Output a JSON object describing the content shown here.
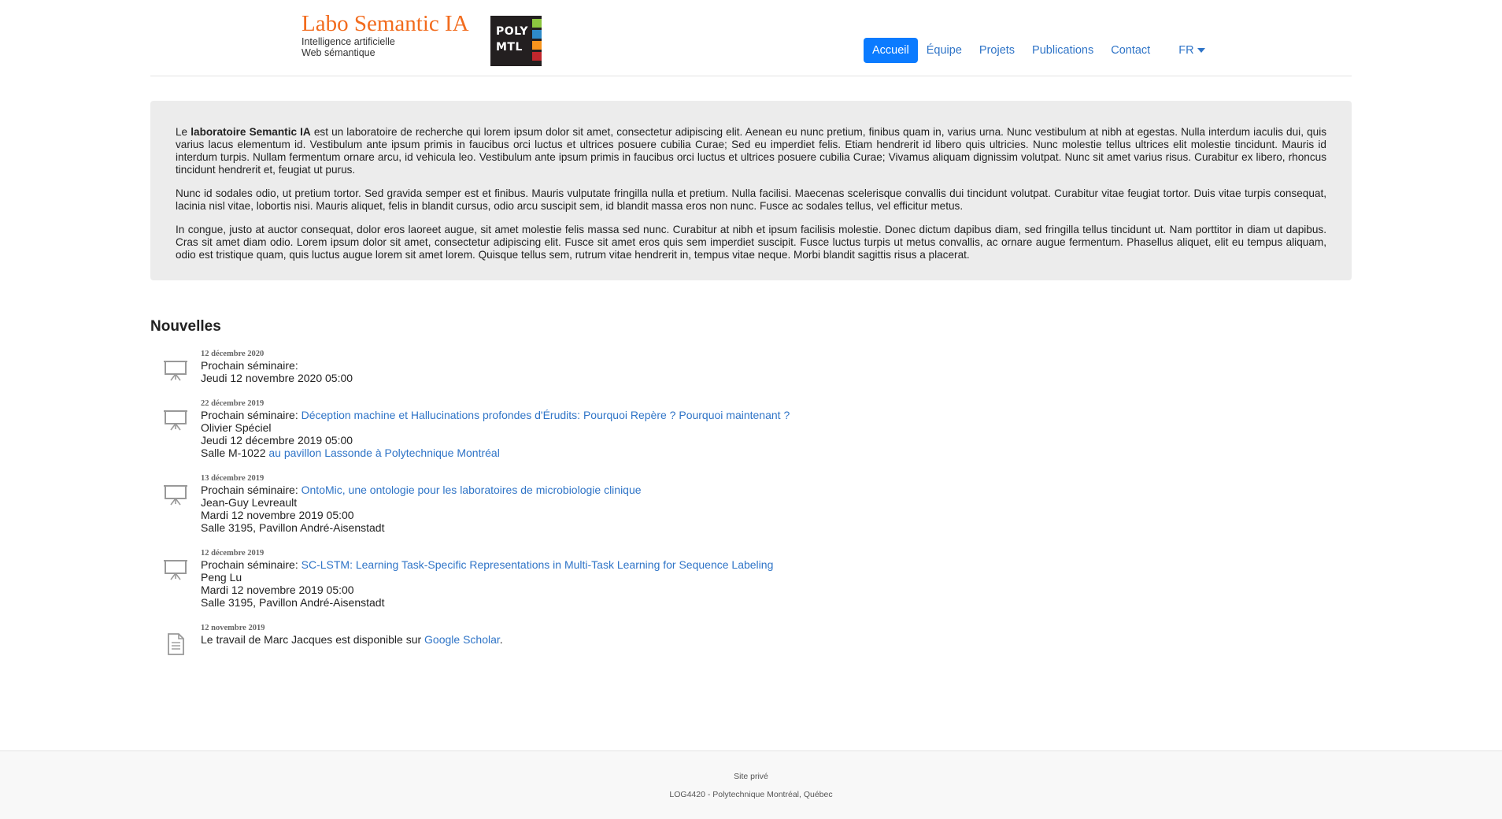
{
  "brand": {
    "title": "Labo Semantic IA",
    "subtitle_1": "Intelligence artificielle",
    "subtitle_2": "Web sémantique",
    "logo_line_1": "POLY",
    "logo_line_2": "MTL",
    "logo_colors": [
      "#8cc63f",
      "#2e8bc9",
      "#f7941d",
      "#c1272d"
    ]
  },
  "nav": {
    "items": [
      {
        "label": "Accueil",
        "active": true
      },
      {
        "label": "Équipe"
      },
      {
        "label": "Projets"
      },
      {
        "label": "Publications"
      },
      {
        "label": "Contact"
      }
    ],
    "lang": "FR"
  },
  "intro": {
    "p1_prefix": "Le ",
    "p1_bold": "laboratoire Semantic IA",
    "p1_rest": " est un laboratoire de recherche qui lorem ipsum dolor sit amet, consectetur adipiscing elit. Aenean eu nunc pretium, finibus quam in, varius urna. Nunc vestibulum at nibh at egestas. Nulla interdum iaculis dui, quis varius lacus elementum id. Vestibulum ante ipsum primis in faucibus orci luctus et ultrices posuere cubilia Curae; Sed eu imperdiet felis. Etiam hendrerit id libero quis ultricies. Nunc molestie tellus ultrices elit molestie tincidunt. Mauris id interdum turpis. Nullam fermentum ornare arcu, id vehicula leo. Vestibulum ante ipsum primis in faucibus orci luctus et ultrices posuere cubilia Curae; Vivamus aliquam dignissim volutpat. Nunc sit amet varius risus. Curabitur ex libero, rhoncus tincidunt hendrerit et, feugiat ut purus.",
    "p2": "Nunc id sodales odio, ut pretium tortor. Sed gravida semper est et finibus. Mauris vulputate fringilla nulla et pretium. Nulla facilisi. Maecenas scelerisque convallis dui tincidunt volutpat. Curabitur vitae feugiat tortor. Duis vitae turpis consequat, lacinia nisl vitae, lobortis nisi. Mauris aliquet, felis in blandit cursus, odio arcu suscipit sem, id blandit massa eros non nunc. Fusce ac sodales tellus, vel efficitur metus.",
    "p3": "In congue, justo at auctor consequat, dolor eros laoreet augue, sit amet molestie felis massa sed nunc. Curabitur at nibh et ipsum facilisis molestie. Donec dictum dapibus diam, sed fringilla tellus tincidunt ut. Nam porttitor in diam ut dapibus. Cras sit amet diam odio. Lorem ipsum dolor sit amet, consectetur adipiscing elit. Fusce sit amet eros quis sem imperdiet suscipit. Fusce luctus turpis ut metus convallis, ac ornare augue fermentum. Phasellus aliquet, elit eu tempus aliquam, odio est tristique quam, quis luctus augue lorem sit amet lorem. Quisque tellus sem, rutrum vitae hendrerit in, tempus vitae neque. Morbi blandit sagittis risus a placerat."
  },
  "news": {
    "title": "Nouvelles",
    "items": [
      {
        "date": "12 décembre 2020",
        "prefix": "Prochain séminaire:",
        "link": "",
        "lines": [
          "Jeudi 12 novembre 2020 05:00"
        ]
      },
      {
        "date": "22 décembre 2019",
        "prefix": "Prochain séminaire:",
        "link": "Déception machine et Hallucinations profondes d'Érudits: Pourquoi Repère ? Pourquoi maintenant ?",
        "lines": [
          "Olivier Spéciel",
          "Jeudi 12 décembre 2019 05:00"
        ],
        "room_prefix": "Salle M-1022",
        "room_link": "au pavillon Lassonde à Polytechnique Montréal"
      },
      {
        "date": "13 décembre 2019",
        "prefix": "Prochain séminaire:",
        "link": "OntoMic, une ontologie pour les laboratoires de microbiologie clinique",
        "lines": [
          "Jean-Guy Levreault",
          "Mardi 12 novembre 2019 05:00",
          "Salle 3195, Pavillon André-Aisenstadt"
        ]
      },
      {
        "date": "12 décembre 2019",
        "prefix": "Prochain séminaire:",
        "link": "SC-LSTM: Learning Task-Specific Representations in Multi-Task Learning for Sequence Labeling",
        "lines": [
          "Peng Lu",
          "Mardi 12 novembre 2019 05:00",
          "Salle 3195, Pavillon André-Aisenstadt"
        ]
      },
      {
        "date": "12 novembre 2019",
        "text_before": "Le travail de Marc Jacques est disponible sur ",
        "link": "Google Scholar",
        "text_after": "."
      }
    ]
  },
  "footer": {
    "private": "Site privé",
    "copy": "LOG4420 - Polytechnique Montréal, Québec"
  }
}
